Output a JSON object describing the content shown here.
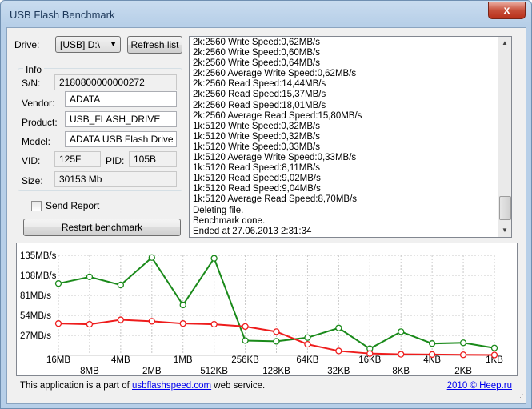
{
  "window": {
    "title": "USB Flash Benchmark",
    "close_glyph": "x"
  },
  "drive": {
    "label": "Drive:",
    "selected": "[USB] D:\\",
    "refresh_label": "Refresh list"
  },
  "info": {
    "group_title": "Info",
    "sn_label": "S/N:",
    "sn": "2180800000000272",
    "vendor_label": "Vendor:",
    "vendor": "ADATA",
    "product_label": "Product:",
    "product": "USB_FLASH_DRIVE",
    "model_label": "Model:",
    "model": "ADATA USB Flash Drive",
    "vid_label": "VID:",
    "vid": "125F",
    "pid_label": "PID:",
    "pid": "105B",
    "size_label": "Size:",
    "size": "30153 Mb"
  },
  "send_report": {
    "label": "Send Report",
    "checked": false
  },
  "restart_label": "Restart benchmark",
  "log": [
    "2k:2560 Write Speed:0,62MB/s",
    "2k:2560 Write Speed:0,60MB/s",
    "2k:2560 Write Speed:0,64MB/s",
    "2k:2560 Average Write Speed:0,62MB/s",
    "2k:2560 Read Speed:14,44MB/s",
    "2k:2560 Read Speed:15,37MB/s",
    "2k:2560 Read Speed:18,01MB/s",
    "2k:2560 Average Read Speed:15,80MB/s",
    "1k:5120 Write Speed:0,32MB/s",
    "1k:5120 Write Speed:0,32MB/s",
    "1k:5120 Write Speed:0,33MB/s",
    "1k:5120 Average Write Speed:0,33MB/s",
    "1k:5120 Read Speed:8,11MB/s",
    "1k:5120 Read Speed:9,02MB/s",
    "1k:5120 Read Speed:9,04MB/s",
    "1k:5120 Average Read Speed:8,70MB/s",
    "Deleting file.",
    "Benchmark done.",
    "Ended at 27.06.2013 2:31:34"
  ],
  "chart_data": {
    "type": "line",
    "categories": [
      "16MB",
      "8MB",
      "4MB",
      "2MB",
      "1MB",
      "512KB",
      "256KB",
      "128KB",
      "64KB",
      "32KB",
      "16KB",
      "8KB",
      "4KB",
      "2KB",
      "1KB"
    ],
    "ylim": [
      0,
      135
    ],
    "yticks": [
      135,
      108,
      81,
      54,
      27
    ],
    "ytick_labels": [
      "135MB/s",
      "108MB/s",
      "81MB/s",
      "54MB/s",
      "27MB/s"
    ],
    "series": [
      {
        "color": "#1a8a1a",
        "values": [
          97,
          106,
          95,
          132,
          68,
          131,
          20,
          19,
          24,
          37,
          9,
          32,
          16,
          17,
          10
        ]
      },
      {
        "color": "#ee1c1c",
        "values": [
          43,
          42,
          48,
          46,
          43,
          42,
          39,
          32,
          15,
          6,
          2.5,
          1.5,
          1.2,
          0.8,
          0.5
        ]
      }
    ],
    "grid": true
  },
  "footer": {
    "text_before": "This application is a part of ",
    "link": "usbflashspeed.com",
    "text_after": " web service.",
    "copyright": "2010 © Heep.ru"
  }
}
